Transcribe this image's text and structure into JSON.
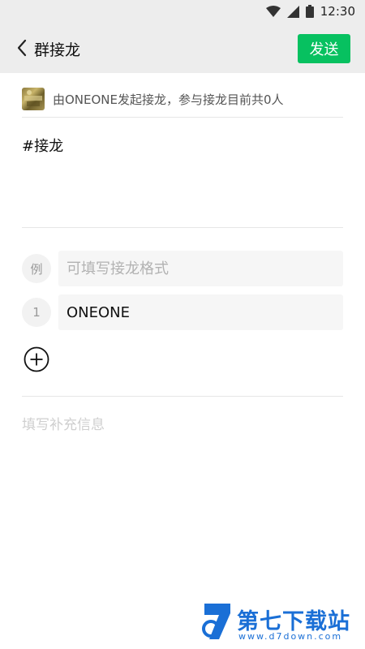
{
  "status_bar": {
    "time": "12:30",
    "icons": [
      "wifi-icon",
      "signal-icon",
      "battery-icon"
    ]
  },
  "nav": {
    "title": "群接龙",
    "send_label": "发送"
  },
  "creator": {
    "text": "由ONEONE发起接龙，参与接龙目前共0人"
  },
  "topic": {
    "text": "#接龙"
  },
  "entries": [
    {
      "label": "例",
      "placeholder": "可填写接龙格式",
      "value": ""
    },
    {
      "label": "1",
      "placeholder": "",
      "value": "ONEONE"
    }
  ],
  "extra_info": {
    "placeholder": "填写补充信息"
  },
  "watermark": {
    "title": "第七下载站",
    "url": "www.d7down.com"
  },
  "colors": {
    "accent": "#07c160",
    "bar_bg": "#ededed",
    "watermark": "#1a6fd6"
  }
}
